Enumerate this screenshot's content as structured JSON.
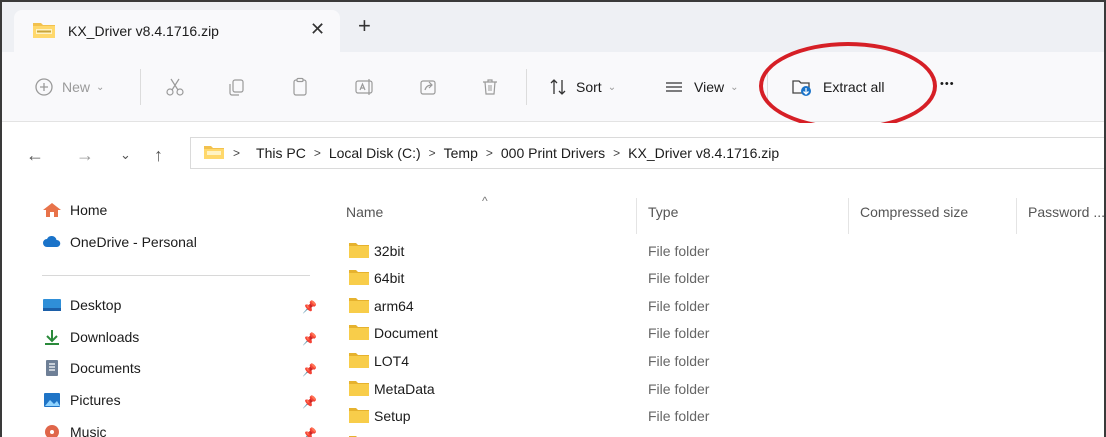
{
  "tab": {
    "title": "KX_Driver v8.4.1716.zip",
    "close": "✕",
    "new_tab": "+"
  },
  "toolbar": {
    "new_label": "New",
    "sort_label": "Sort",
    "view_label": "View",
    "extract_label": "Extract all",
    "more_label": "•••",
    "highlight_color": "#d61f26"
  },
  "address": {
    "crumbs": [
      "This PC",
      "Local Disk (C:)",
      "Temp",
      "000 Print Drivers",
      "KX_Driver v8.4.1716.zip"
    ]
  },
  "sidebar": {
    "items": [
      {
        "label": "Home",
        "icon": "home-icon"
      },
      {
        "label": "OneDrive - Personal",
        "icon": "cloud-icon"
      },
      {
        "label": "Desktop",
        "icon": "desktop-icon",
        "pinned": true
      },
      {
        "label": "Downloads",
        "icon": "download-icon",
        "pinned": true
      },
      {
        "label": "Documents",
        "icon": "documents-icon",
        "pinned": true
      },
      {
        "label": "Pictures",
        "icon": "pictures-icon",
        "pinned": true
      },
      {
        "label": "Music",
        "icon": "music-icon",
        "pinned": true
      }
    ]
  },
  "columns": {
    "name": "Name",
    "type": "Type",
    "compressed": "Compressed size",
    "password": "Password ..."
  },
  "files": [
    {
      "name": "32bit",
      "type": "File folder"
    },
    {
      "name": "64bit",
      "type": "File folder"
    },
    {
      "name": "arm64",
      "type": "File folder"
    },
    {
      "name": "Document",
      "type": "File folder"
    },
    {
      "name": "LOT4",
      "type": "File folder"
    },
    {
      "name": "MetaData",
      "type": "File folder"
    },
    {
      "name": "Setup",
      "type": "File folder"
    }
  ]
}
